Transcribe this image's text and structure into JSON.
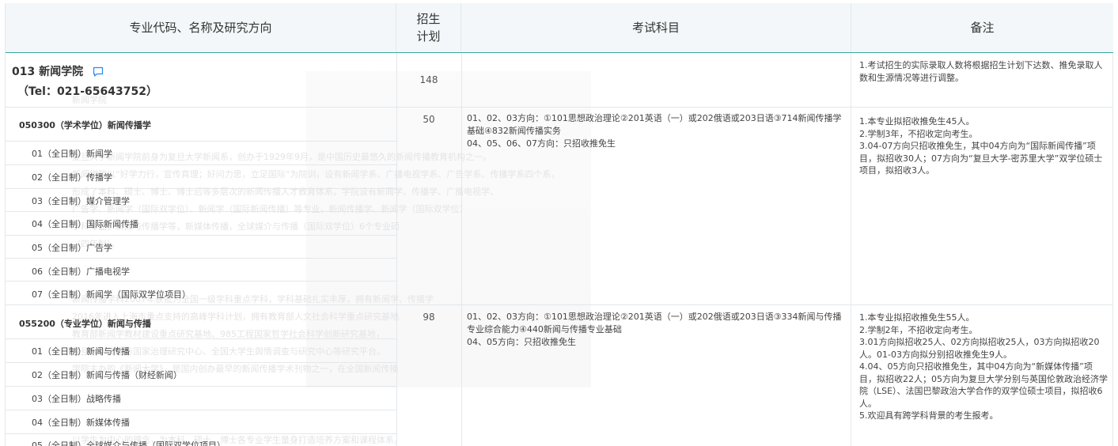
{
  "header": {
    "col_major": "专业代码、名称及研究方向",
    "col_quota": "招生\n计划",
    "col_exam": "考试科目",
    "col_note": "备注"
  },
  "college": {
    "name": "013 新闻学院",
    "tel": "（Tel：021-65643752）",
    "quota": "148",
    "note": "1.考试招生的实际录取人数将根据招生计划下达数、推免录取人数和生源情况等进行调整。"
  },
  "majors": [
    {
      "title": "050300（学术学位）新闻传播学",
      "quota": "50",
      "exam": [
        "01、02、03方向：①101思想政治理论②201英语（一）或202俄语或203日语③714新闻传播学基础④832新闻传播实务",
        "04、05、06、07方向：只招收推免生"
      ],
      "note": [
        "1.本专业拟招收推免生45人。",
        "2.学制3年，不招收定向考生。",
        "3.04-07方向只招收推免生，其中04方向为“国际新闻传播”项目，拟招收30人；07方向为“复旦大学-密苏里大学”双学位硕士项目，拟招收3人。"
      ],
      "directions": [
        "01（全日制）新闻学",
        "02（全日制）传播学",
        "03（全日制）媒介管理学",
        "04（全日制）国际新闻传播",
        "05（全日制）广告学",
        "06（全日制）广播电视学",
        "07（全日制）新闻学（国际双学位项目）"
      ]
    },
    {
      "title": "055200（专业学位）新闻与传播",
      "quota": "98",
      "exam": [
        "01、02、03方向：①101思想政治理论②201英语（一）或202俄语或203日语③334新闻与传播专业综合能力④440新闻与传播专业基础",
        "04、05方向：只招收推免生"
      ],
      "note": [
        "1.本专业拟招收推免生55人。",
        "2.学制2年，不招收定向考生。",
        "3.01方向拟招收25人、02方向拟招收25人，03方向拟招收20人。01-03方向拟分别招收推免生9人。",
        "4.04、05方向只招收推免生，其中04方向为“新媒体传播”项目，拟招收22人；05方向为复旦大学分别与英国伦敦政治经济学院（LSE）、法国巴黎政治大学合作的双学位硕士项目，拟招收6人。",
        "5.欢迎具有跨学科背景的考生报考。"
      ],
      "directions": [
        "01（全日制）新闻与传播",
        "02（全日制）新闻与传播（财经新闻）",
        "03（全日制）战略传播",
        "04（全日制）新媒体传播",
        "05（全日制）全球媒介与传播（国际双学位项目）"
      ]
    }
  ],
  "colors": {
    "accent": "#3aa99b",
    "header_bg": "#f3f7f9",
    "border": "#e3e8eb",
    "icon": "#2d8cf0"
  },
  "watermark_lines": [
    "新闻学院",
    "复旦大学新闻学院前身为复旦大学新闻系，创办于1929年9月，是中国历史最悠久的新闻传播教育机构之一。",
    "新闻学院以“好学力行，宣传真理；好问力思，立足国际”为院训，设有新闻学系、广播电视学系、广告学系、传播学系四个系，",
    "形成了本科、硕士、博士、博士后等多层次的新闻传播人才教育体系。学院设有新闻学、传播学、广播电视学、",
    "广告学、新闻学（国际双学位）、新闻学（国际新闻传播）等专业，新闻传播学、新闻学（国际双学位）",
    "学科专业，新闻与传播学等，新媒体传播，全球媒介与传播（国际双学位）6个专业硕",
    "（四年制）。",
    "新闻传播学科2007年获批为全国一级学科重点学科，学科基础扎实丰厚，拥有新闻学、传播学",
    "2016年进入上海市重点支持的高峰学科计划，拥有教育部人文社会科学重点研究基地",
    "教育部新闻学教材建设重点研究基地、985工程国家哲学社会科学创新研究基地，",
    "复旦大学传播与国家治理研究中心、全国大学生舆情调查与研究中心等研究平台。",
    "学院主办的《新闻大学》，是国内创办最早的新闻传播学术刊物之一，在全国新闻传播",
    "以学生为中心的理念，为本科、硕士、博士各专业学生量身打造培养方案和课程体系。"
  ]
}
